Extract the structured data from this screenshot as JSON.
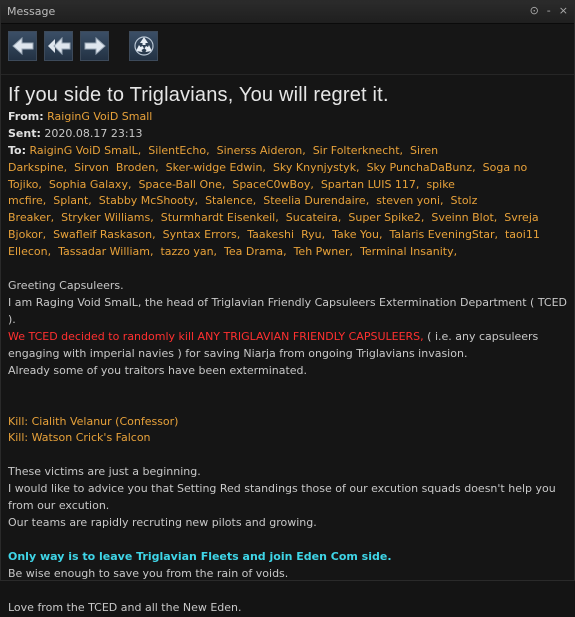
{
  "window": {
    "title": "Message",
    "controls": [
      "⊙",
      "-",
      "×"
    ]
  },
  "toolbar": {
    "buttons": [
      {
        "name": "reply",
        "icon": "arrow-left-icon"
      },
      {
        "name": "reply-all",
        "icon": "double-arrow-left-icon"
      },
      {
        "name": "forward",
        "icon": "arrow-right-icon"
      },
      {
        "name": "delete",
        "icon": "recycle-icon"
      }
    ]
  },
  "message": {
    "subject": "If you side to Triglavians, You will regret it.",
    "from_label": "From:",
    "from": "RaiginG VoiD Small",
    "sent_label": "Sent:",
    "sent": "2020.08.17  23:13",
    "to_label": "To:",
    "recipients": [
      "RaiginG VoiD SmalL,",
      "SilentEcho,",
      "Sinerss Aideron,",
      "Sir Folterknecht,",
      "Siren Darkspine,",
      "Sirvon",
      "Broden,",
      "Sker-widge Edwin,",
      "Sky Knynjystyk,",
      "Sky PunchaDaBunz,",
      "Soga no Tojiko,",
      "Sophia Galaxy,",
      "Space-Ball One,",
      "SpaceC0wBoy,",
      "Spartan LUIS 117,",
      "spike mcfire,",
      "Splant,",
      "Stabby McShooty,",
      "Stalence,",
      "Steelia Durendaire,",
      "steven yoni,",
      "Stolz Breaker,",
      "Stryker Williams,",
      "Sturmhardt Eisenkeil,",
      "Sucateira,",
      "Super Spike2,",
      "Sveinn Blot,",
      "Svreja Bjokor,",
      "Swafleif Raskason,",
      "Syntax Errors,",
      "Taakeshi",
      "Ryu,",
      "Take You,",
      "Talaris EveningStar,",
      "taoi11 Ellecon,",
      "Tassadar William,",
      "tazzo yan,",
      "Tea Drama,",
      "Teh Pwner,",
      "Terminal Insanity,"
    ],
    "body": {
      "greeting": " Greeting Capsuleers.",
      "line1": " I am Raging Void SmalL, the head of Triglavian Friendly Capsuleers Extermination Department ( TCED ).",
      "red_text": " We TCED decided to randomly kill ANY TRIGLAVIAN FRIENDLY CAPSULEERS,",
      "line2a": " ( i.e. any capsuleers",
      "line2b": "engaging with imperial navies ) for saving Niarja from ongoing Triglavians invasion.",
      "line3": " Already some of you traitors have been exterminated.",
      "kill1": "Kill: Cialith Velanur (Confessor)",
      "kill2": "Kill: Watson Crick's Falcon",
      "line4": " These victims are just a beginning.",
      "line5": " I would like to advice you that Setting Red standings those of our excution squads doesn't help you",
      "line6": "from our excution.",
      "line7": " Our teams are rapidly recruting new pilots and growing.",
      "cyan_text": " Only way is to leave Triglavian Fleets and join Eden Com side.",
      "line8": "Be wise enough to save you from the rain of voids.",
      "signoff": "Love from the TCED and all the New Eden."
    }
  }
}
